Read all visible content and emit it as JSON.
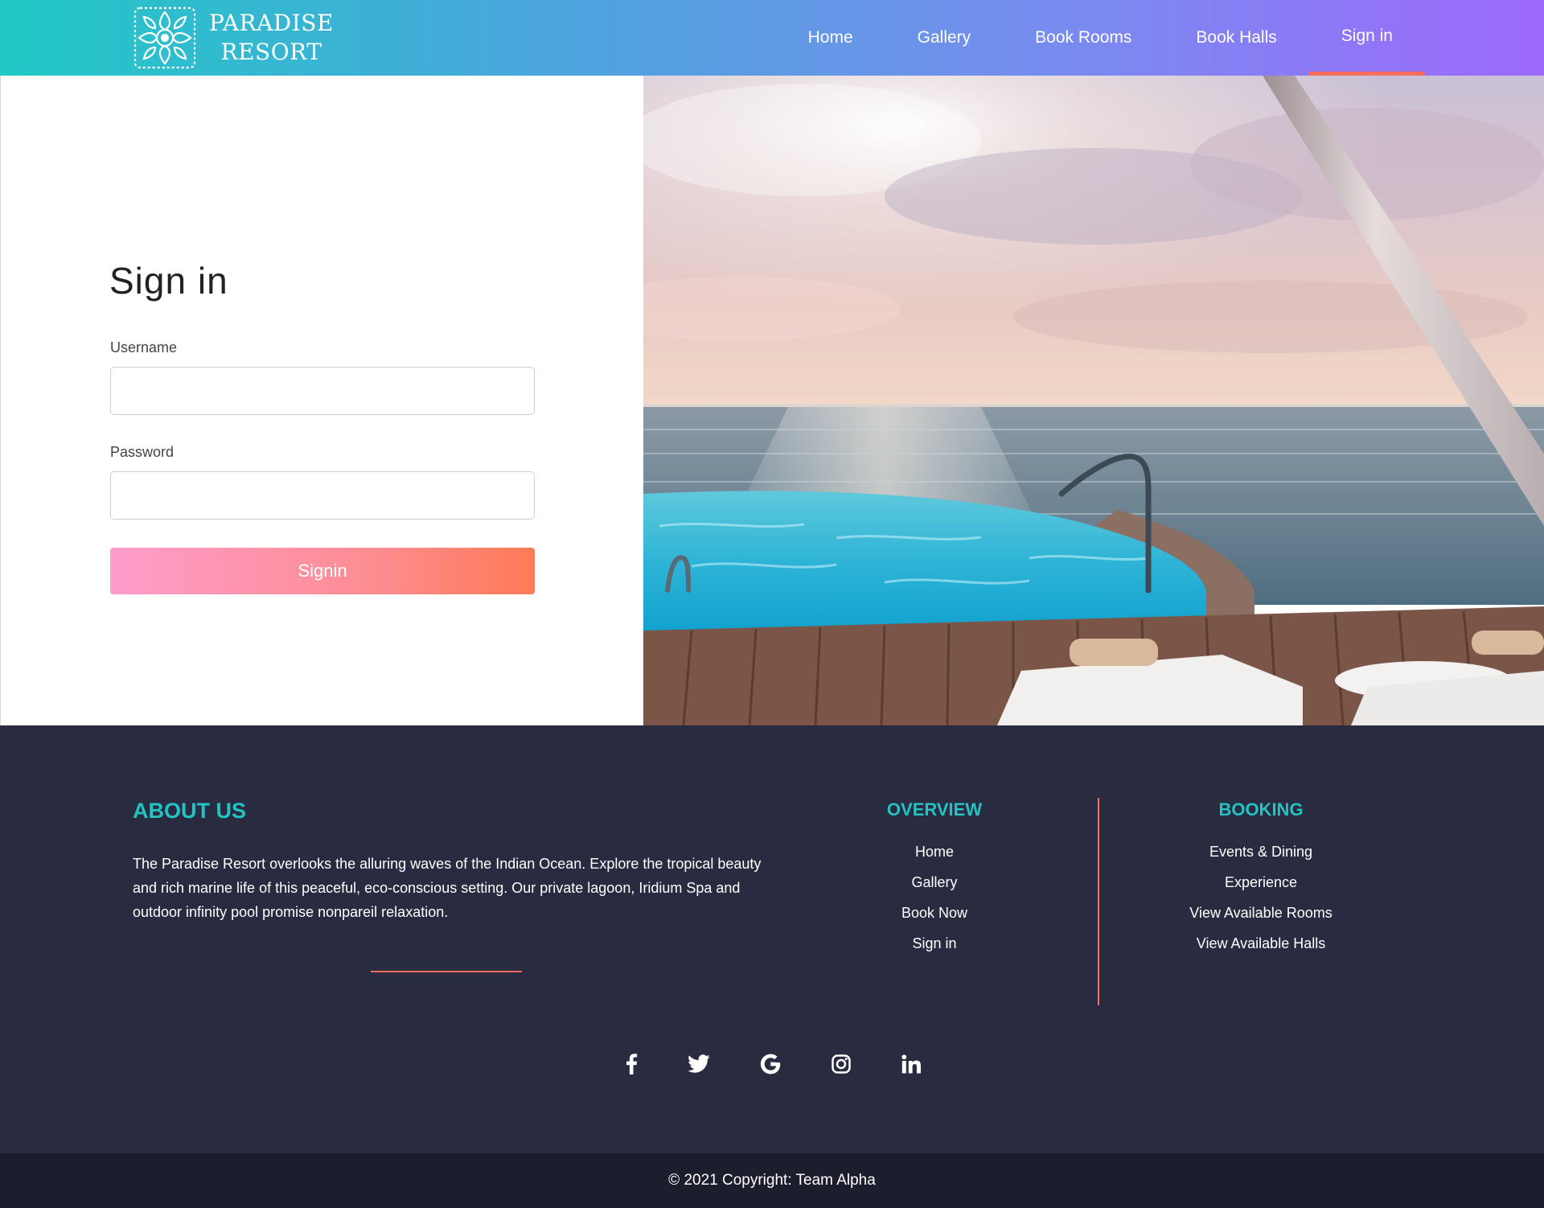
{
  "brand": {
    "name_line1": "PARADISE",
    "name_line2": "RESORT",
    "logo_icon": "ornamental-mandala-icon"
  },
  "nav": {
    "items": [
      {
        "label": "Home",
        "active": false
      },
      {
        "label": "Gallery",
        "active": false
      },
      {
        "label": "Book Rooms",
        "active": false
      },
      {
        "label": "Book Halls",
        "active": false
      },
      {
        "label": "Sign in",
        "active": true
      }
    ]
  },
  "signin": {
    "title": "Sign in",
    "username_label": "Username",
    "username_value": "",
    "password_label": "Password",
    "password_value": "",
    "submit_label": "Signin"
  },
  "hero": {
    "image": "infinity-pool-ocean-sunset-photo"
  },
  "footer": {
    "about": {
      "title": "ABOUT US",
      "text": "The Paradise Resort overlooks the alluring waves of the Indian Ocean. Explore the tropical beauty and rich marine life of this peaceful, eco-conscious setting. Our private lagoon, Iridium Spa and outdoor infinity pool promise nonpareil relaxation."
    },
    "overview": {
      "title": "OVERVIEW",
      "links": [
        "Home",
        "Gallery",
        "Book Now",
        "Sign in"
      ]
    },
    "booking": {
      "title": "BOOKING",
      "links": [
        "Events & Dining",
        "Experience",
        "View Available Rooms",
        "View Available Halls"
      ]
    },
    "socials": [
      "facebook-icon",
      "twitter-icon",
      "google-icon",
      "instagram-icon",
      "linkedin-icon"
    ],
    "copyright": "© 2021 Copyright: Team Alpha"
  },
  "colors": {
    "nav_gradient_start": "#21c8c6",
    "nav_gradient_end": "#9d69fb",
    "accent": "#fa6d5d",
    "footer_heading": "#24c3c3",
    "footer_bg": "#292b40",
    "copyright_bg": "#1d1e2d",
    "button_gradient_start": "#ff9ccb",
    "button_gradient_end": "#ff7a57"
  }
}
